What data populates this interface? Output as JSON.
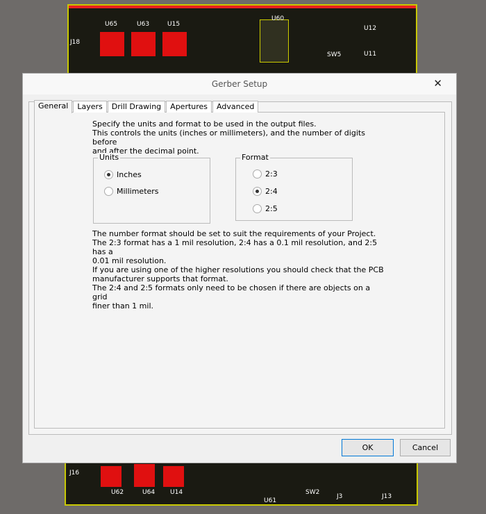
{
  "pcb_labels": {
    "top": [
      "U65",
      "U63",
      "U15",
      "U60",
      "U12",
      "U11",
      "SW5",
      "J18"
    ],
    "bottom": [
      "U62",
      "U64",
      "U14",
      "U61",
      "SW2",
      "J3",
      "J13",
      "J16"
    ]
  },
  "dialog": {
    "title": "Gerber Setup",
    "close": "✕",
    "tabs": [
      "General",
      "Layers",
      "Drill Drawing",
      "Apertures",
      "Advanced"
    ],
    "intro": [
      "Specify the units and format to be used in the output files.",
      "This controls the units (inches or millimeters), and the number of digits before",
      "and after the decimal point."
    ],
    "units": {
      "title": "Units",
      "options": [
        "Inches",
        "Millimeters"
      ],
      "selected": "Inches"
    },
    "format": {
      "title": "Format",
      "options": [
        "2:3",
        "2:4",
        "2:5"
      ],
      "selected": "2:4"
    },
    "notes": [
      "The number format should be set to suit the requirements of your Project.",
      "The 2:3 format has a 1 mil resolution, 2:4 has a 0.1 mil resolution, and 2:5 has a",
      "0.01 mil resolution.",
      "If you are using one of the higher resolutions you should check that the PCB",
      "manufacturer supports that format.",
      "The 2:4 and 2:5 formats only need to be chosen if there are objects on a grid",
      "finer than 1 mil."
    ],
    "ok": "OK",
    "cancel": "Cancel"
  },
  "colors": {
    "board": "#1a1a12",
    "copper": "#e01010",
    "dialog": "#f0f0f0"
  }
}
